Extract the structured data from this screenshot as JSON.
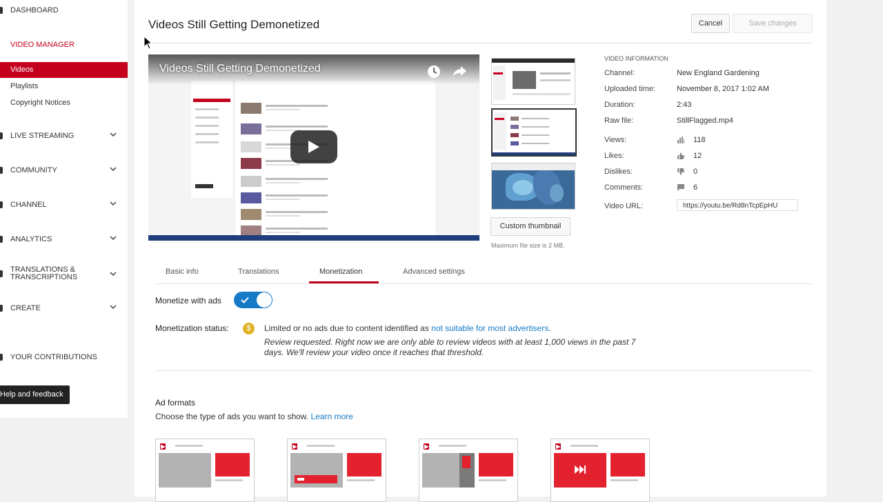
{
  "sidebar": {
    "dashboard": "DASHBOARD",
    "video_manager": "VIDEO MANAGER",
    "sub_items": [
      "Videos",
      "Playlists",
      "Copyright Notices"
    ],
    "sections": [
      "LIVE STREAMING",
      "COMMUNITY",
      "CHANNEL",
      "ANALYTICS",
      "TRANSLATIONS &",
      "TRANSCRIPTIONS",
      "CREATE"
    ],
    "your_contributions": "YOUR CONTRIBUTIONS",
    "help": "Help and feedback"
  },
  "header": {
    "title": "Videos Still Getting Demonetized",
    "cancel": "Cancel",
    "save": "Save changes"
  },
  "player": {
    "title": "Videos Still Getting Demonetized"
  },
  "thumbnails": {
    "custom_button": "Custom thumbnail",
    "max_size": "Maximum file size is 2 MB."
  },
  "video_info": {
    "heading": "VIDEO INFORMATION",
    "channel_label": "Channel:",
    "channel": "New England Gardening",
    "uploaded_label": "Uploaded time:",
    "uploaded": "November 8, 2017 1:02 AM",
    "duration_label": "Duration:",
    "duration": "2:43",
    "raw_label": "Raw file:",
    "raw_file": "StillFlagged.mp4",
    "views_label": "Views:",
    "views": "118",
    "likes_label": "Likes:",
    "likes": "12",
    "dislikes_label": "Dislikes:",
    "dislikes": "0",
    "comments_label": "Comments:",
    "comments": "6",
    "url_label": "Video URL:",
    "url": "https://youtu.be/Rd8nTcpEpHU"
  },
  "tabs": [
    "Basic info",
    "Translations",
    "Monetization",
    "Advanced settings"
  ],
  "monetization": {
    "monetize_label": "Monetize with ads",
    "status_label": "Monetization status:",
    "status_text": "Limited or no ads due to content identified as ",
    "status_link": "not suitable for most advertisers",
    "status_end": ".",
    "note": "Review requested.   Right now we are only able to review videos with at least 1,000 views in the past 7 days.   We'll review your video once it reaches that threshold.",
    "ad_formats_title": "Ad formats",
    "ad_formats_desc": "Choose the type of ads you want to show. ",
    "learn_more": "Learn more",
    "dollar_symbol": "$"
  },
  "colors": {
    "accent": "#c4001d",
    "link": "#167ac6",
    "toggle": "#167ac6",
    "dollar": "#e0b227"
  },
  "icons": [
    "clock-icon",
    "share-icon",
    "play-icon",
    "views-icon",
    "like-icon",
    "dislike-icon",
    "comment-icon",
    "chevron-down-icon",
    "check-icon",
    "dollar-icon"
  ]
}
